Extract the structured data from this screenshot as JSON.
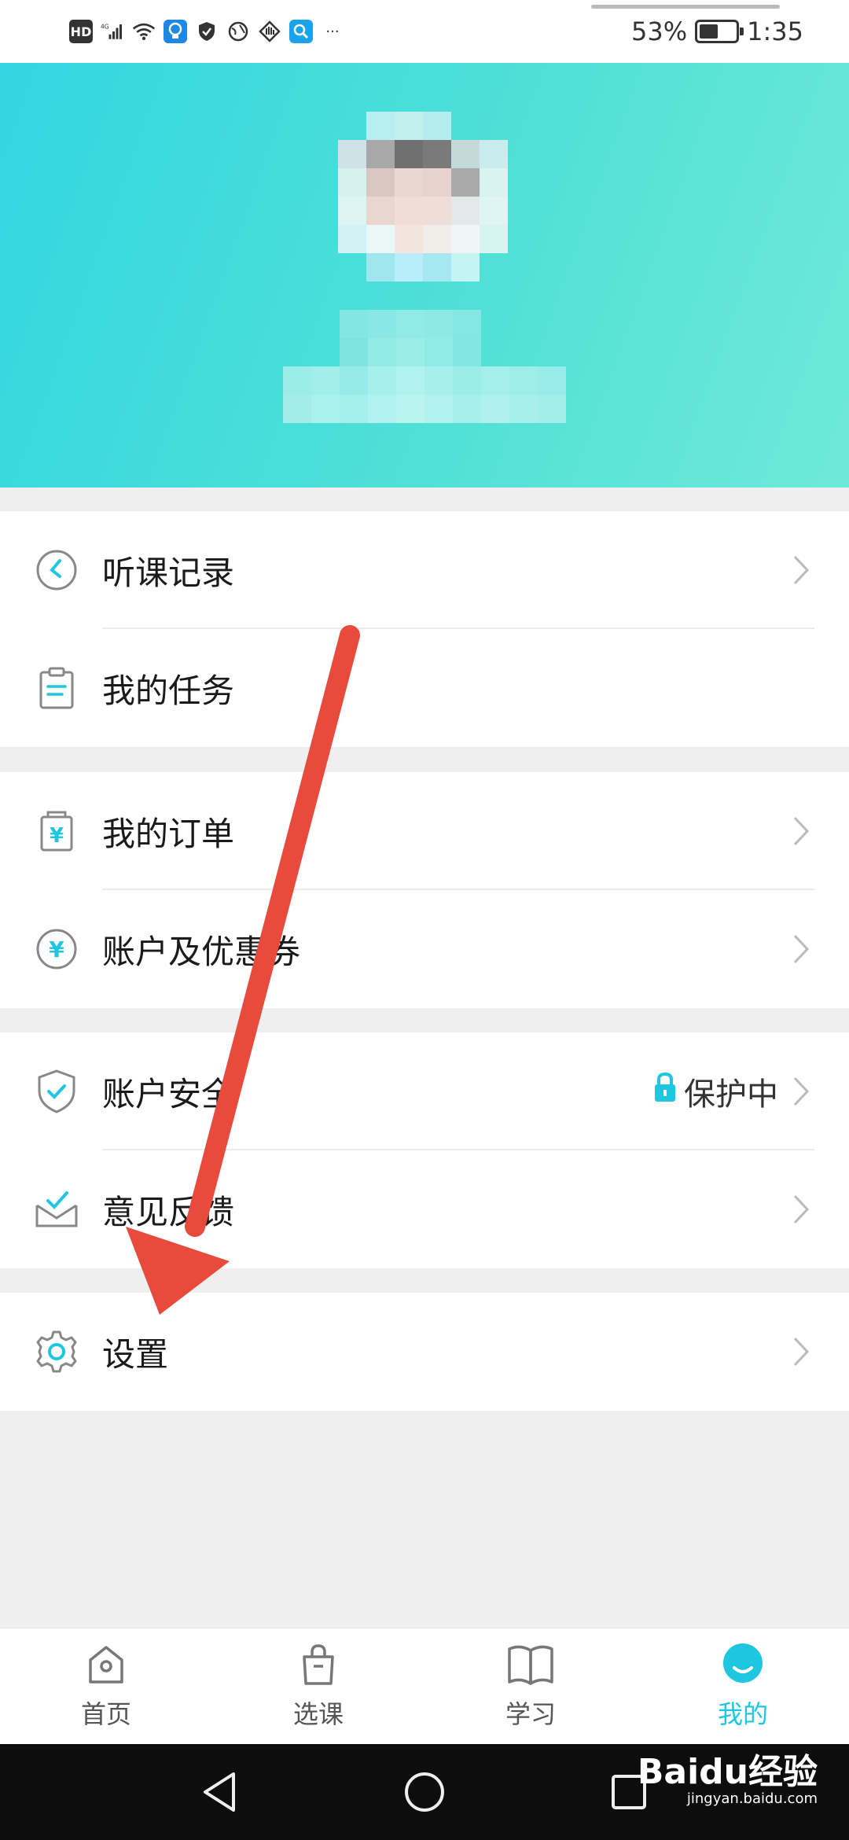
{
  "status_bar": {
    "hd": "HD",
    "network": "4G",
    "battery_percent": "53%",
    "battery_level": 0.53,
    "time": "1:35",
    "more": "···"
  },
  "menu": {
    "group1": [
      {
        "label": "听课记录",
        "icon": "clock-back-icon"
      },
      {
        "label": "我的任务",
        "icon": "clipboard-icon"
      }
    ],
    "group2": [
      {
        "label": "我的订单",
        "icon": "order-bag-icon"
      },
      {
        "label": "账户及优惠券",
        "icon": "yuan-coin-icon"
      }
    ],
    "group3": [
      {
        "label": "账户安全",
        "icon": "shield-check-icon",
        "status": "保护中"
      },
      {
        "label": "意见反馈",
        "icon": "feedback-icon"
      }
    ],
    "group4": [
      {
        "label": "设置",
        "icon": "gear-icon"
      }
    ]
  },
  "bottom_nav": [
    {
      "label": "首页",
      "icon": "home-icon"
    },
    {
      "label": "选课",
      "icon": "shopping-bag-icon"
    },
    {
      "label": "学习",
      "icon": "book-icon"
    },
    {
      "label": "我的",
      "icon": "profile-face-icon",
      "active": true
    }
  ],
  "watermark": {
    "brand": "Baidu经验",
    "url": "jingyan.baidu.com"
  },
  "colors": {
    "accent": "#1ec7df",
    "header_gradient_start": "#33d6e2",
    "header_gradient_end": "#6fe9d9",
    "arrow": "#e84a3c"
  }
}
